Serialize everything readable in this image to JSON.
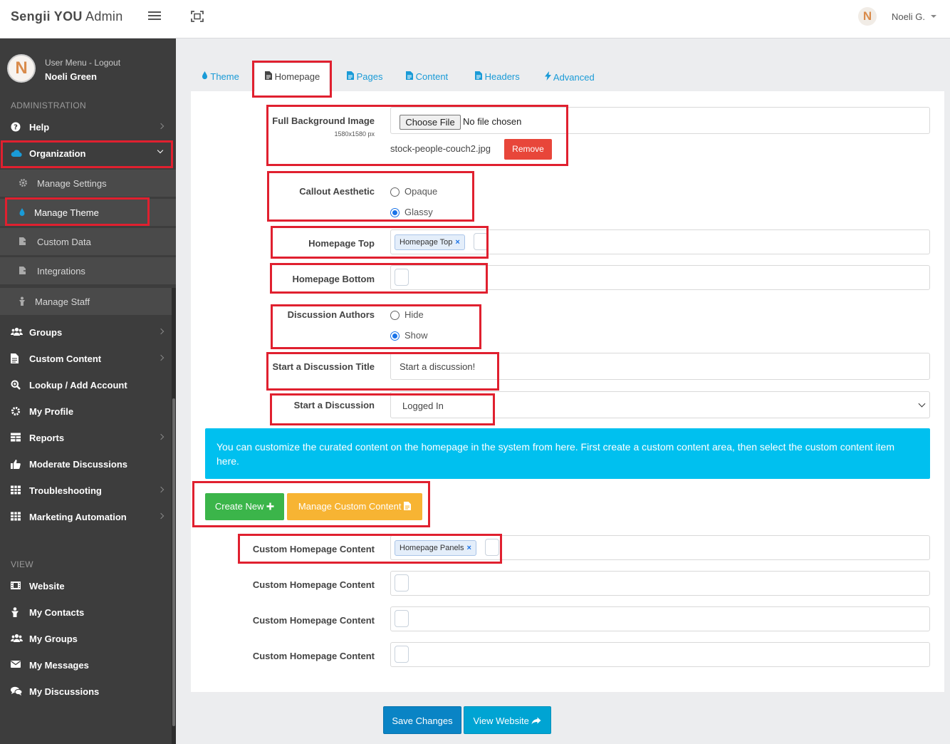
{
  "app": {
    "brand_bold": "Sengii YOU",
    "brand_rest": " Admin"
  },
  "topbar": {
    "avatar_letter": "N",
    "user": "Noeli G."
  },
  "sidebar": {
    "avatar_letter": "N",
    "user_menu": "User Menu - Logout",
    "user_name": "Noeli Green",
    "admin_heading": "ADMINISTRATION",
    "view_heading": "VIEW",
    "admin_items": {
      "help": "Help",
      "organization": "Organization",
      "manage_settings": "Manage Settings",
      "manage_theme": "Manage Theme",
      "custom_data": "Custom Data",
      "integrations": "Integrations",
      "manage_staff": "Manage Staff",
      "groups": "Groups",
      "custom_content": "Custom Content",
      "lookup": "Lookup / Add Account",
      "my_profile": "My Profile",
      "reports": "Reports",
      "moderate": "Moderate Discussions",
      "troubleshooting": "Troubleshooting",
      "marketing": "Marketing Automation"
    },
    "view_items": {
      "website": "Website",
      "my_contacts": "My Contacts",
      "my_groups": "My Groups",
      "my_messages": "My Messages",
      "my_discussions": "My Discussions"
    }
  },
  "tabs": {
    "theme": "Theme",
    "homepage": "Homepage",
    "pages": "Pages",
    "content": "Content",
    "headers": "Headers",
    "advanced": "Advanced"
  },
  "form": {
    "bg_label": "Full Background Image",
    "bg_size": "1580x1580 px",
    "choose_file": "Choose File",
    "no_file": "No file chosen",
    "current_file": "stock-people-couch2.jpg",
    "remove": "Remove",
    "callout_label": "Callout Aesthetic",
    "callout_opt1": "Opaque",
    "callout_opt2": "Glassy",
    "homepage_top_label": "Homepage Top",
    "homepage_top_tag": "Homepage Top",
    "homepage_bottom_label": "Homepage Bottom",
    "discussion_authors_label": "Discussion Authors",
    "authors_opt1": "Hide",
    "authors_opt2": "Show",
    "start_title_label": "Start a Discussion Title",
    "start_title_value": "Start a discussion!",
    "start_label": "Start a Discussion",
    "start_value": "Logged In",
    "info_text": "You can customize the curated content on the homepage in the system from here. First create a custom content area, then select the custom content item here.",
    "create_new": "Create New",
    "manage_custom": "Manage Custom Content",
    "custom_label_1": "Custom Homepage Content",
    "custom_tag_1": "Homepage Panels",
    "custom_label_2": "Custom Homepage Content",
    "custom_label_3": "Custom Homepage Content",
    "custom_label_4": "Custom Homepage Content",
    "save": "Save Changes",
    "view_website": "View Website"
  },
  "colors": {
    "highlight": "#e0202f",
    "link": "#1a9bd7",
    "info": "#00c0ef",
    "green": "#3bb54a",
    "orange": "#f7b433",
    "save": "#0a84c5"
  }
}
